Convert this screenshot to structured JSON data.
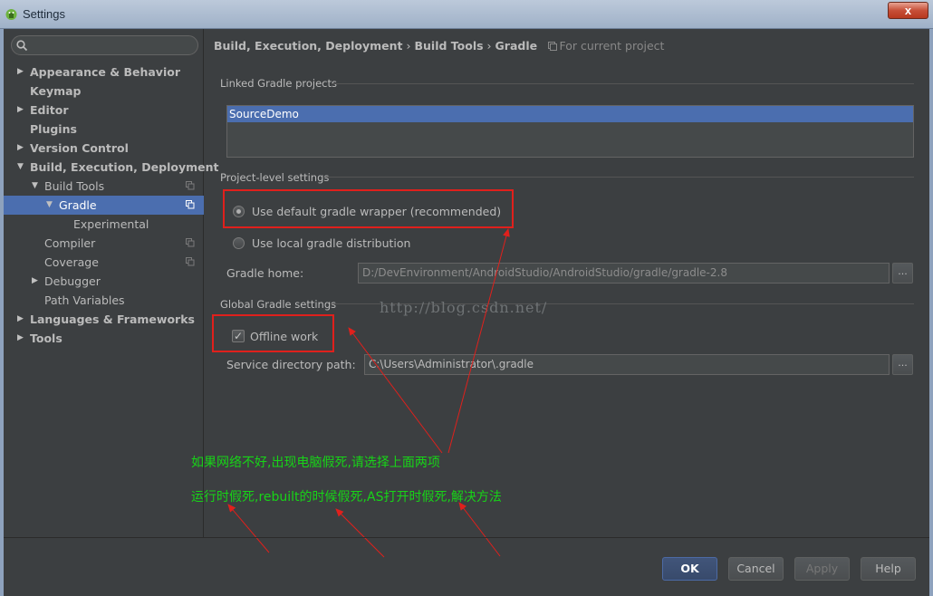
{
  "window": {
    "title": "Settings",
    "close_label": "x"
  },
  "sidebar": {
    "items": [
      {
        "label": "Appearance & Behavior",
        "level": 0,
        "arrow": "▶",
        "bold": true
      },
      {
        "label": "Keymap",
        "level": 0,
        "arrow": "",
        "bold": true
      },
      {
        "label": "Editor",
        "level": 0,
        "arrow": "▶",
        "bold": true
      },
      {
        "label": "Plugins",
        "level": 0,
        "arrow": "",
        "bold": true
      },
      {
        "label": "Version Control",
        "level": 0,
        "arrow": "▶",
        "bold": true
      },
      {
        "label": "Build, Execution, Deployment",
        "level": 0,
        "arrow": "▼",
        "bold": true
      },
      {
        "label": "Build Tools",
        "level": 1,
        "arrow": "▼",
        "bold": false,
        "copy": true
      },
      {
        "label": "Gradle",
        "level": 2,
        "arrow": "▼",
        "bold": false,
        "copy": true,
        "selected": true
      },
      {
        "label": "Experimental",
        "level": 3,
        "arrow": "",
        "bold": false
      },
      {
        "label": "Compiler",
        "level": 1,
        "arrow": "",
        "bold": false,
        "copy": true
      },
      {
        "label": "Coverage",
        "level": 1,
        "arrow": "",
        "bold": false,
        "copy": true
      },
      {
        "label": "Debugger",
        "level": 1,
        "arrow": "▶",
        "bold": false
      },
      {
        "label": "Path Variables",
        "level": 1,
        "arrow": "",
        "bold": false
      },
      {
        "label": "Languages & Frameworks",
        "level": 0,
        "arrow": "▶",
        "bold": true
      },
      {
        "label": "Tools",
        "level": 0,
        "arrow": "▶",
        "bold": true
      }
    ]
  },
  "breadcrumb": {
    "part1": "Build, Execution, Deployment",
    "sep": "›",
    "part2": "Build Tools",
    "part3": "Gradle",
    "project_note": "For current project"
  },
  "linked": {
    "title": "Linked Gradle projects",
    "projects": [
      "SourceDemo"
    ]
  },
  "project_level": {
    "title": "Project-level settings",
    "option_default": "Use default gradle wrapper (recommended)",
    "option_local": "Use local gradle distribution",
    "gradle_home_label": "Gradle home:",
    "gradle_home_value": "D:/DevEnvironment/AndroidStudio/AndroidStudio/gradle/gradle-2.8",
    "browse_label": "..."
  },
  "global": {
    "title": "Global Gradle settings",
    "offline_label": "Offline work",
    "offline_checked": true,
    "service_dir_label": "Service directory path:",
    "service_dir_value": "C:\\Users\\Administrator\\.gradle",
    "browse_label": "..."
  },
  "watermark": "http://blog.csdn.net/",
  "annotations": {
    "line1": "如果网络不好,出现电脑假死,请选择上面两项",
    "line2": "运行时假死,rebuilt的时候假死,AS打开时假死,解决方法"
  },
  "buttons": {
    "ok": "OK",
    "cancel": "Cancel",
    "apply": "Apply",
    "help": "Help"
  },
  "colors": {
    "annotation": "#17d417",
    "highlight": "#e0201c",
    "selection": "#4b6eaf"
  }
}
